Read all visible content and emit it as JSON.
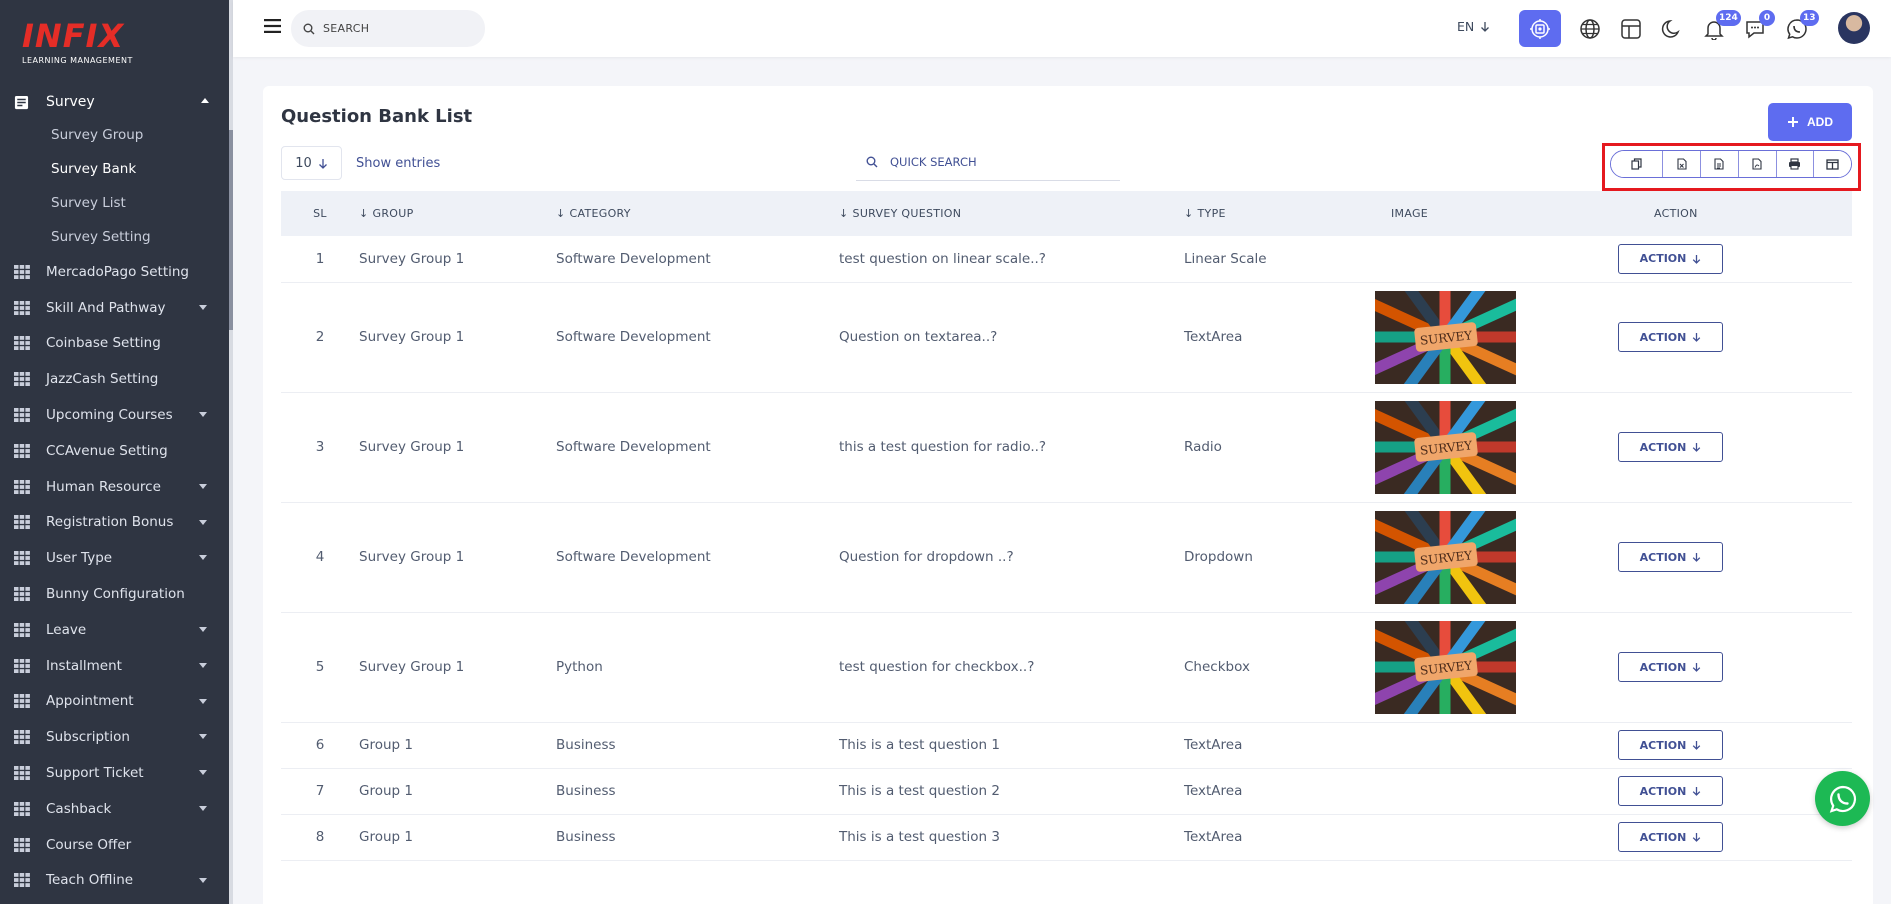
{
  "logo": {
    "main": "INFIX",
    "sub": "LEARNING MANAGEMENT"
  },
  "sidebar": {
    "parent": {
      "label": "Survey"
    },
    "subitems": [
      {
        "label": "Survey Group"
      },
      {
        "label": "Survey Bank"
      },
      {
        "label": "Survey List"
      },
      {
        "label": "Survey Setting"
      }
    ],
    "items": [
      {
        "label": "MercadoPago Setting"
      },
      {
        "label": "Skill And Pathway"
      },
      {
        "label": "Coinbase Setting"
      },
      {
        "label": "JazzCash Setting"
      },
      {
        "label": "Upcoming Courses"
      },
      {
        "label": "CCAvenue Setting"
      },
      {
        "label": "Human Resource"
      },
      {
        "label": "Registration Bonus"
      },
      {
        "label": "User Type"
      },
      {
        "label": "Bunny Configuration"
      },
      {
        "label": "Leave"
      },
      {
        "label": "Installment"
      },
      {
        "label": "Appointment"
      },
      {
        "label": "Subscription"
      },
      {
        "label": "Support Ticket"
      },
      {
        "label": "Cashback"
      },
      {
        "label": "Course Offer"
      },
      {
        "label": "Teach Offline"
      }
    ]
  },
  "header": {
    "search_placeholder": "SEARCH",
    "language": "EN",
    "badges": {
      "notifications": "124",
      "messages": "0",
      "whatsapp": "13"
    }
  },
  "main": {
    "title": "Question Bank List",
    "add_label": "ADD",
    "entries_value": "10",
    "show_entries": "Show entries",
    "quick_search_placeholder": "QUICK SEARCH",
    "columns": {
      "sl": "SL",
      "group": "GROUP",
      "category": "CATEGORY",
      "question": "SURVEY QUESTION",
      "type": "TYPE",
      "image": "IMAGE",
      "action": "ACTION"
    },
    "image_label": "SURVEY",
    "action_label": "ACTION",
    "rows": [
      {
        "sl": "1",
        "group": "Survey Group 1",
        "category": "Software Development",
        "question": "test question on linear scale..?",
        "type": "Linear Scale"
      },
      {
        "sl": "2",
        "group": "Survey Group 1",
        "category": "Software Development",
        "question": "Question on textarea..?",
        "type": "TextArea"
      },
      {
        "sl": "3",
        "group": "Survey Group 1",
        "category": "Software Development",
        "question": "this a test question for radio..?",
        "type": "Radio"
      },
      {
        "sl": "4",
        "group": "Survey Group 1",
        "category": "Software Development",
        "question": "Question for dropdown ..?",
        "type": "Dropdown"
      },
      {
        "sl": "5",
        "group": "Survey Group 1",
        "category": "Python",
        "question": "test question for checkbox..?",
        "type": "Checkbox"
      },
      {
        "sl": "6",
        "group": "Group 1",
        "category": "Business",
        "question": "This is a test question 1",
        "type": "TextArea"
      },
      {
        "sl": "7",
        "group": "Group 1",
        "category": "Business",
        "question": "This is a test question 2",
        "type": "TextArea"
      },
      {
        "sl": "8",
        "group": "Group 1",
        "category": "Business",
        "question": "This is a test question 3",
        "type": "TextArea"
      }
    ]
  },
  "colors": {
    "accent": "#5e6cf0",
    "sidebar": "#2f3542",
    "brand": "#e52d27",
    "highlight": "#e5191f",
    "whatsapp": "#1db954"
  }
}
